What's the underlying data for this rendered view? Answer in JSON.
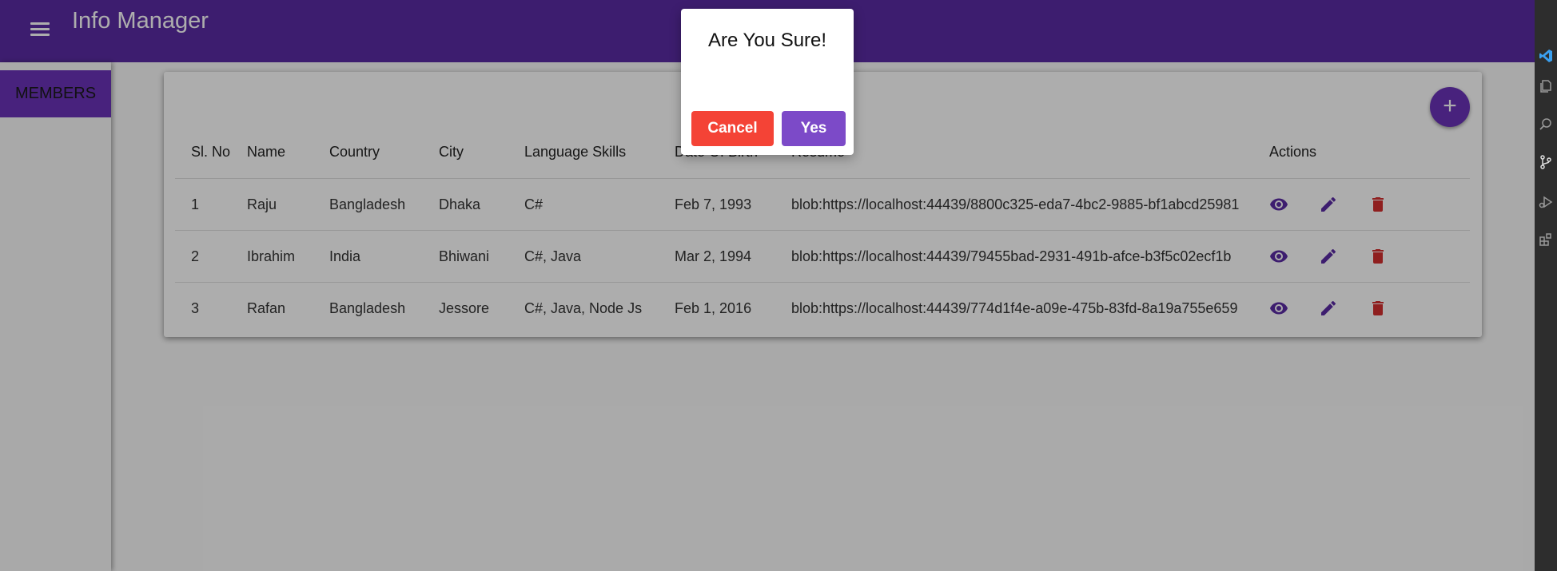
{
  "app": {
    "title": "Info Manager"
  },
  "sidebar": {
    "items": [
      {
        "label": "MEMBERS"
      }
    ]
  },
  "table": {
    "columns": [
      "Sl. No",
      "Name",
      "Country",
      "City",
      "Language Skills",
      "Date Of Birth",
      "Resume",
      "Actions"
    ],
    "rows": [
      {
        "sl": "1",
        "name": "Raju",
        "country": "Bangladesh",
        "city": "Dhaka",
        "skills": "C#",
        "dob": "Feb 7, 1993",
        "resume": "blob:https://localhost:44439/8800c325-eda7-4bc2-9885-bf1abcd25981"
      },
      {
        "sl": "2",
        "name": "Ibrahim",
        "country": "India",
        "city": "Bhiwani",
        "skills": "C#, Java",
        "dob": "Mar 2, 1994",
        "resume": "blob:https://localhost:44439/79455bad-2931-491b-afce-b3f5c02ecf1b"
      },
      {
        "sl": "3",
        "name": "Rafan",
        "country": "Bangladesh",
        "city": "Jessore",
        "skills": "C#, Java, Node Js",
        "dob": "Feb 1, 2016",
        "resume": "blob:https://localhost:44439/774d1f4e-a09e-475b-83fd-8a19a755e659"
      }
    ]
  },
  "fab": {
    "icon": "plus-icon",
    "label": "+"
  },
  "actions": {
    "view_icon": "eye-icon",
    "edit_icon": "pencil-icon",
    "delete_icon": "trash-icon"
  },
  "dialog": {
    "title": "Are You Sure!",
    "cancel_label": "Cancel",
    "yes_label": "Yes"
  },
  "colors": {
    "primary": "#5b2ca4",
    "accent": "#6a33b8",
    "danger": "#f44336",
    "yes": "#7c4ac8",
    "delete_icon": "#d32f2f"
  }
}
